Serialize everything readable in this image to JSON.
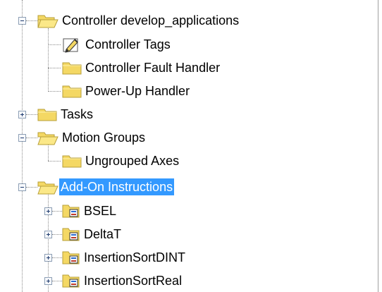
{
  "tree": {
    "controller": {
      "label": "Controller develop_applications",
      "icon": "folder-open-icon",
      "children": {
        "tags": {
          "label": "Controller Tags",
          "icon": "tag-edit-icon"
        },
        "fault_handler": {
          "label": "Controller Fault Handler",
          "icon": "folder-icon"
        },
        "powerup_handler": {
          "label": "Power-Up Handler",
          "icon": "folder-icon"
        }
      }
    },
    "tasks": {
      "label": "Tasks",
      "icon": "folder-icon"
    },
    "motion_groups": {
      "label": "Motion Groups",
      "icon": "folder-open-icon",
      "children": {
        "ungrouped_axes": {
          "label": "Ungrouped Axes",
          "icon": "folder-icon"
        }
      }
    },
    "aoi": {
      "label": "Add-On Instructions",
      "icon": "folder-open-icon",
      "selected": true,
      "children": [
        {
          "label": "BSEL",
          "icon": "add-on-instruction-icon"
        },
        {
          "label": "DeltaT",
          "icon": "add-on-instruction-icon"
        },
        {
          "label": "InsertionSortDINT",
          "icon": "add-on-instruction-icon"
        },
        {
          "label": "InsertionSortReal",
          "icon": "add-on-instruction-icon"
        }
      ]
    }
  },
  "colors": {
    "selection": "#3399ff",
    "folder": "#f4d864",
    "folder_edge": "#b79f3a",
    "connector": "#8a8a8a"
  }
}
